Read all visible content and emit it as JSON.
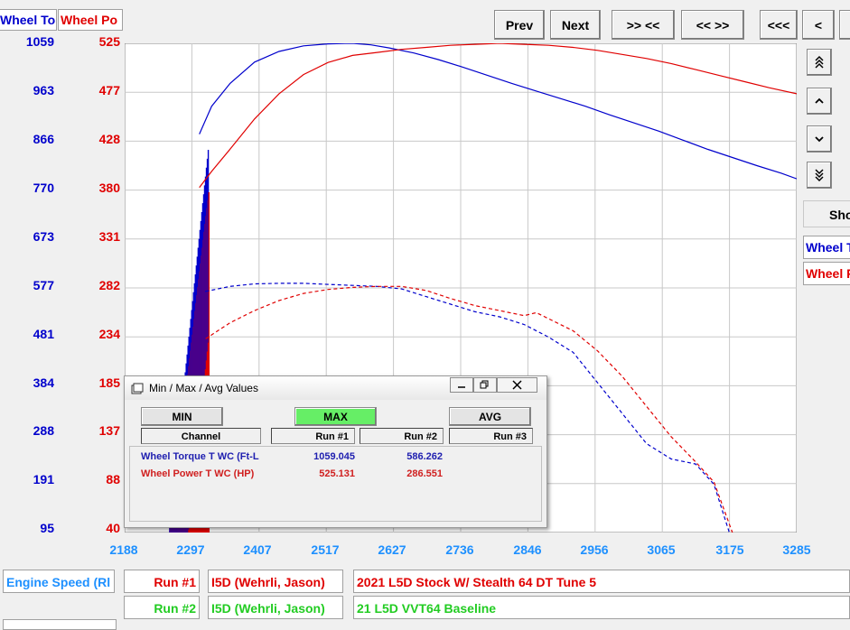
{
  "header": {
    "torque_channel": "Wheel To",
    "power_channel": "Wheel Po",
    "buttons": {
      "prev": "Prev",
      "next": "Next",
      "zoom_in": ">> <<",
      "zoom_out": "<< >>",
      "page_left": "<<<",
      "scroll_left": "<"
    }
  },
  "side": {
    "show_label": "Sho",
    "torque_label": "Wheel T",
    "power_label": "Wheel P",
    "icons": [
      "double-up-icon",
      "up-icon",
      "down-icon",
      "double-down-icon"
    ]
  },
  "axes": {
    "torque_ticks": [
      "1059",
      "963",
      "866",
      "770",
      "673",
      "577",
      "481",
      "384",
      "288",
      "191",
      "95"
    ],
    "power_ticks": [
      "525",
      "477",
      "428",
      "380",
      "331",
      "282",
      "234",
      "185",
      "137",
      "88",
      "40"
    ],
    "x_ticks": [
      "2188",
      "2297",
      "2407",
      "2517",
      "2627",
      "2736",
      "2846",
      "2956",
      "3065",
      "3175",
      "3285"
    ]
  },
  "colors": {
    "torque": "#0000cc",
    "power": "#e00000",
    "x_axis": "#1e90ff",
    "run1": "#e00000",
    "run2": "#22cc22",
    "max_button": "#66ee66"
  },
  "chart_data": {
    "type": "line",
    "xlabel": "Engine Speed (Rl",
    "xlim": [
      2188,
      3285
    ],
    "y_left": {
      "range": [
        95,
        1059
      ]
    },
    "y_right": {
      "range": [
        40,
        525
      ]
    },
    "series": [
      {
        "name": "Wheel Torque T WC (Ft-L",
        "run": "Run #1",
        "style": "solid",
        "axis": "left",
        "x": [
          2310,
          2330,
          2360,
          2400,
          2440,
          2480,
          2520,
          2560,
          2590,
          2620,
          2660,
          2700,
          2740,
          2780,
          2820,
          2860,
          2900,
          2940,
          2980,
          3020,
          3060,
          3100,
          3140,
          3180,
          3220,
          3260,
          3285
        ],
        "y": [
          880,
          935,
          980,
          1022,
          1043,
          1054,
          1058,
          1059,
          1056,
          1050,
          1040,
          1027,
          1012,
          996,
          980,
          965,
          950,
          935,
          918,
          902,
          886,
          868,
          850,
          834,
          818,
          803,
          792
        ]
      },
      {
        "name": "Wheel Power T WC (HP)",
        "run": "Run #1",
        "style": "solid",
        "axis": "right",
        "x": [
          2310,
          2330,
          2360,
          2400,
          2440,
          2480,
          2520,
          2560,
          2600,
          2640,
          2680,
          2720,
          2760,
          2800,
          2840,
          2880,
          2920,
          2960,
          3000,
          3040,
          3080,
          3120,
          3160,
          3200,
          3240,
          3285
        ],
        "y": [
          382,
          398,
          420,
          450,
          475,
          494,
          506,
          513,
          516,
          519,
          521,
          523,
          524,
          525,
          524,
          523,
          521,
          518,
          514,
          510,
          505,
          499,
          493,
          487,
          481,
          475
        ]
      },
      {
        "name": "Wheel Torque T WC (Ft-L",
        "run": "Run #2",
        "style": "dashed",
        "axis": "left",
        "x": [
          2320,
          2360,
          2400,
          2440,
          2480,
          2520,
          2560,
          2600,
          2640,
          2680,
          2720,
          2760,
          2800,
          2840,
          2880,
          2920,
          2960,
          3000,
          3040,
          3080,
          3120,
          3150,
          3175
        ],
        "y": [
          570,
          580,
          585,
          586,
          586,
          584,
          582,
          580,
          575,
          560,
          545,
          530,
          520,
          505,
          480,
          450,
          390,
          330,
          270,
          240,
          230,
          190,
          95
        ]
      },
      {
        "name": "Wheel Power T WC (HP)",
        "run": "Run #2",
        "style": "dashed",
        "axis": "right",
        "x": [
          2320,
          2360,
          2400,
          2440,
          2480,
          2520,
          2560,
          2600,
          2640,
          2680,
          2720,
          2760,
          2800,
          2840,
          2860,
          2880,
          2920,
          2960,
          3000,
          3040,
          3080,
          3120,
          3150,
          3180
        ],
        "y": [
          232,
          248,
          260,
          270,
          277,
          281,
          283,
          284,
          284,
          280,
          272,
          265,
          260,
          255,
          258,
          252,
          240,
          220,
          195,
          165,
          135,
          110,
          90,
          40
        ]
      }
    ]
  },
  "dialog": {
    "title": "Min / Max / Avg Values",
    "buttons": {
      "min": "MIN",
      "max": "MAX",
      "avg": "AVG"
    },
    "columns": [
      "Channel",
      "Run #1",
      "Run #2",
      "Run #3"
    ],
    "rows": [
      {
        "channel": "Wheel Torque T WC (Ft-L",
        "run1": "1059.045",
        "run2": "586.262",
        "run3": ""
      },
      {
        "channel": "Wheel Power T WC (HP)",
        "run1": "525.131",
        "run2": "286.551",
        "run3": ""
      }
    ],
    "window_icons": [
      "minimize-icon",
      "restore-icon",
      "close-icon"
    ]
  },
  "footer": {
    "x_channel": "Engine Speed (Rl",
    "runs": [
      {
        "label": "Run #1",
        "vehicle": "I5D (Wehrli, Jason)",
        "description": "2021 L5D Stock W/ Stealth 64 DT Tune 5"
      },
      {
        "label": "Run #2",
        "vehicle": "I5D (Wehrli, Jason)",
        "description": "21 L5D VVT64 Baseline"
      }
    ]
  }
}
